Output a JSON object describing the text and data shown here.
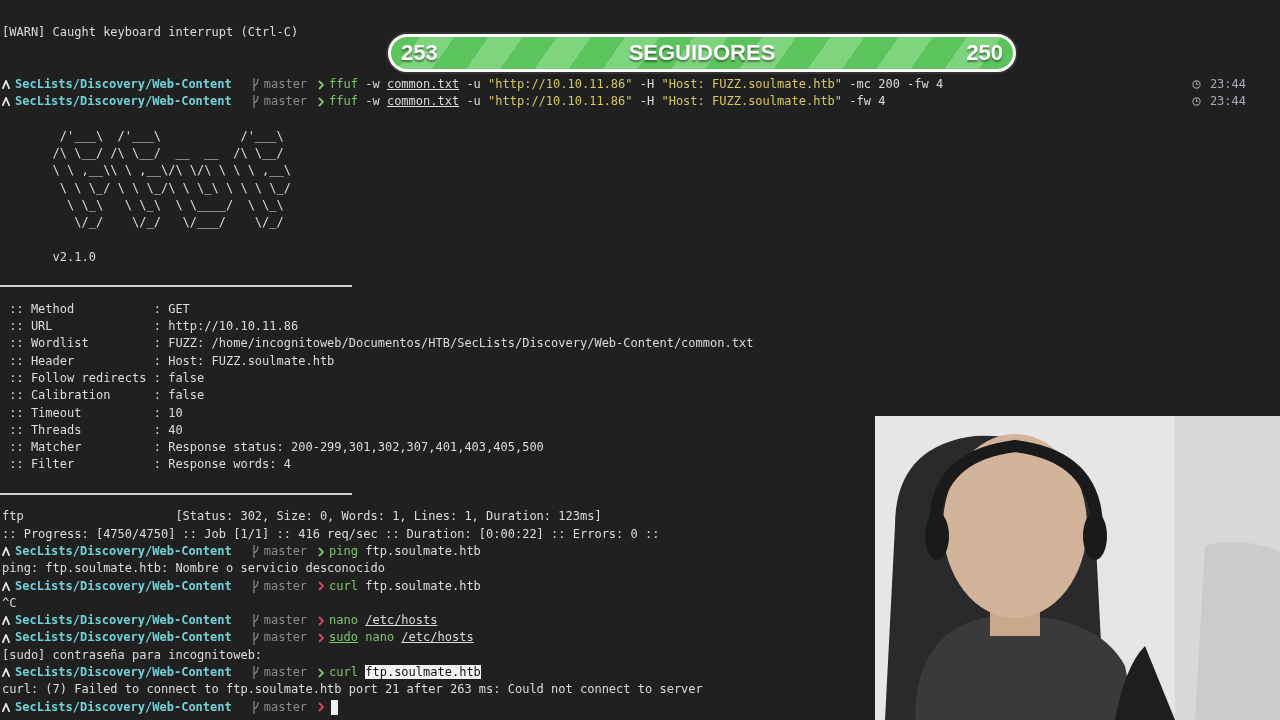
{
  "terminal": {
    "lines": [
      {
        "kind": "text",
        "text": "[WARN] Caught keyboard interrupt (Ctrl-C)"
      },
      {
        "kind": "blank"
      },
      {
        "kind": "blank"
      },
      {
        "kind": "prompt",
        "path": "SecLists/Discovery/Web-Content",
        "branch": "master",
        "color": "#7cc76a",
        "time": "23:44",
        "command": [
          {
            "kind": "cmd",
            "text": "ffuf"
          },
          {
            "kind": "arg",
            "text": "-w"
          },
          {
            "kind": "path",
            "text": "common.txt"
          },
          {
            "kind": "arg",
            "text": "-u"
          },
          {
            "kind": "string",
            "text": "\"http://10.10.11.86\""
          },
          {
            "kind": "arg",
            "text": "-H"
          },
          {
            "kind": "string",
            "text": "\"Host: FUZZ.soulmate.htb\""
          },
          {
            "kind": "arg",
            "text": "-mc 200 -fw 4"
          }
        ]
      },
      {
        "kind": "prompt",
        "path": "SecLists/Discovery/Web-Content",
        "branch": "master",
        "color": "#7cc76a",
        "time": "23:44",
        "command": [
          {
            "kind": "cmd",
            "text": "ffuf"
          },
          {
            "kind": "arg",
            "text": "-w"
          },
          {
            "kind": "path",
            "text": "common.txt"
          },
          {
            "kind": "arg",
            "text": "-u"
          },
          {
            "kind": "string",
            "text": "\"http://10.10.11.86\""
          },
          {
            "kind": "arg",
            "text": "-H"
          },
          {
            "kind": "string",
            "text": "\"Host: FUZZ.soulmate.htb\""
          },
          {
            "kind": "arg",
            "text": "-fw 4"
          }
        ]
      },
      {
        "kind": "blank"
      },
      {
        "kind": "ascii",
        "text": "        /'___\\  /'___\\           /'___\\"
      },
      {
        "kind": "ascii",
        "text": "       /\\ \\__/ /\\ \\__/  __  __  /\\ \\__/"
      },
      {
        "kind": "ascii",
        "text": "       \\ \\ ,__\\\\ \\ ,__\\/\\ \\/\\ \\ \\ \\ ,__\\"
      },
      {
        "kind": "ascii",
        "text": "        \\ \\ \\_/ \\ \\ \\_/\\ \\ \\_\\ \\ \\ \\ \\_/"
      },
      {
        "kind": "ascii",
        "text": "         \\ \\_\\   \\ \\_\\  \\ \\____/  \\ \\_\\"
      },
      {
        "kind": "ascii",
        "text": "          \\/_/    \\/_/   \\/___/    \\/_/"
      },
      {
        "kind": "blank"
      },
      {
        "kind": "text",
        "text": "       v2.1.0"
      },
      {
        "kind": "rule"
      },
      {
        "kind": "blank"
      },
      {
        "kind": "text",
        "text": " :: Method           : GET"
      },
      {
        "kind": "text",
        "text": " :: URL              : http://10.10.11.86"
      },
      {
        "kind": "text",
        "text": " :: Wordlist         : FUZZ: /home/incognitoweb/Documentos/HTB/SecLists/Discovery/Web-Content/common.txt"
      },
      {
        "kind": "text",
        "text": " :: Header           : Host: FUZZ.soulmate.htb"
      },
      {
        "kind": "text",
        "text": " :: Follow redirects : false"
      },
      {
        "kind": "text",
        "text": " :: Calibration      : false"
      },
      {
        "kind": "text",
        "text": " :: Timeout          : 10"
      },
      {
        "kind": "text",
        "text": " :: Threads          : 40"
      },
      {
        "kind": "text",
        "text": " :: Matcher          : Response status: 200-299,301,302,307,401,403,405,500"
      },
      {
        "kind": "text",
        "text": " :: Filter           : Response words: 4"
      },
      {
        "kind": "rule"
      },
      {
        "kind": "blank"
      },
      {
        "kind": "text",
        "text": "ftp                     [Status: 302, Size: 0, Words: 1, Lines: 1, Duration: 123ms]"
      },
      {
        "kind": "text",
        "text": ":: Progress: [4750/4750] :: Job [1/1] :: 416 req/sec :: Duration: [0:00:22] :: Errors: 0 ::"
      },
      {
        "kind": "prompt",
        "path": "SecLists/Discovery/Web-Content",
        "branch": "master",
        "color": "#7cc76a",
        "command": [
          {
            "kind": "cmd",
            "text": "ping"
          },
          {
            "kind": "arg",
            "text": "ftp.soulmate.htb"
          }
        ]
      },
      {
        "kind": "text",
        "text": "ping: ftp.soulmate.htb: Nombre o servicio desconocido"
      },
      {
        "kind": "prompt",
        "path": "SecLists/Discovery/Web-Content",
        "branch": "master",
        "color": "#d9455f",
        "command": [
          {
            "kind": "cmd",
            "text": "curl"
          },
          {
            "kind": "arg",
            "text": "ftp.soulmate.htb"
          }
        ]
      },
      {
        "kind": "text",
        "text": "^C"
      },
      {
        "kind": "prompt",
        "path": "SecLists/Discovery/Web-Content",
        "branch": "master",
        "color": "#d9455f",
        "command": [
          {
            "kind": "cmd",
            "text": "nano"
          },
          {
            "kind": "path",
            "text": "/etc/hosts"
          }
        ]
      },
      {
        "kind": "prompt",
        "path": "SecLists/Discovery/Web-Content",
        "branch": "master",
        "color": "#d9455f",
        "command": [
          {
            "kind": "cmd_path",
            "text": "sudo"
          },
          {
            "kind": "cmd",
            "text": "nano"
          },
          {
            "kind": "path",
            "text": "/etc/hosts"
          }
        ]
      },
      {
        "kind": "text",
        "text": "[sudo] contraseña para incognitoweb:"
      },
      {
        "kind": "prompt",
        "path": "SecLists/Discovery/Web-Content",
        "branch": "master",
        "color": "#7cc76a",
        "command": [
          {
            "kind": "cmd",
            "text": "curl"
          },
          {
            "kind": "selected",
            "text": "ftp.soulmate.htb"
          }
        ]
      },
      {
        "kind": "text",
        "text": "curl: (7) Failed to connect to ftp.soulmate.htb port 21 after 263 ms: Could not connect to server"
      },
      {
        "kind": "prompt",
        "path": "SecLists/Discovery/Web-Content",
        "branch": "master",
        "color": "#d9455f",
        "cursor": true
      }
    ]
  },
  "follower_bar": {
    "current": "253",
    "label": "SEGUIDORES",
    "goal": "250"
  }
}
